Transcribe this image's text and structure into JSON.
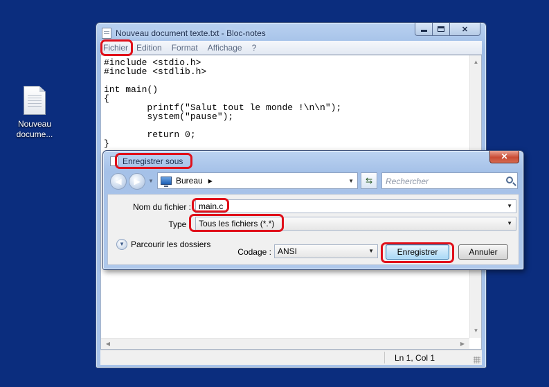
{
  "desktop": {
    "icon_label_line1": "Nouveau",
    "icon_label_line2": "docume..."
  },
  "notepad": {
    "title": "Nouveau document texte.txt - Bloc-notes",
    "menu": [
      "Fichier",
      "Edition",
      "Format",
      "Affichage",
      "?"
    ],
    "code": "#include <stdio.h>\n#include <stdlib.h>\n\nint main()\n{\n        printf(\"Salut tout le monde !\\n\\n\");\n        system(\"pause\");\n\n        return 0;\n}",
    "status_position": "Ln 1, Col 1"
  },
  "save_dialog": {
    "title": "Enregistrer sous",
    "location": "Bureau",
    "search_placeholder": "Rechercher",
    "filename_label": "Nom du fichier :",
    "filename_value": "main.c",
    "type_label": "Type :",
    "type_value": "Tous les fichiers  (*.*)",
    "browse_folders_label": "Parcourir les dossiers",
    "encoding_label": "Codage :",
    "encoding_value": "ANSI",
    "save_button": "Enregistrer",
    "cancel_button": "Annuler"
  },
  "annotation_color": "#e0101a"
}
